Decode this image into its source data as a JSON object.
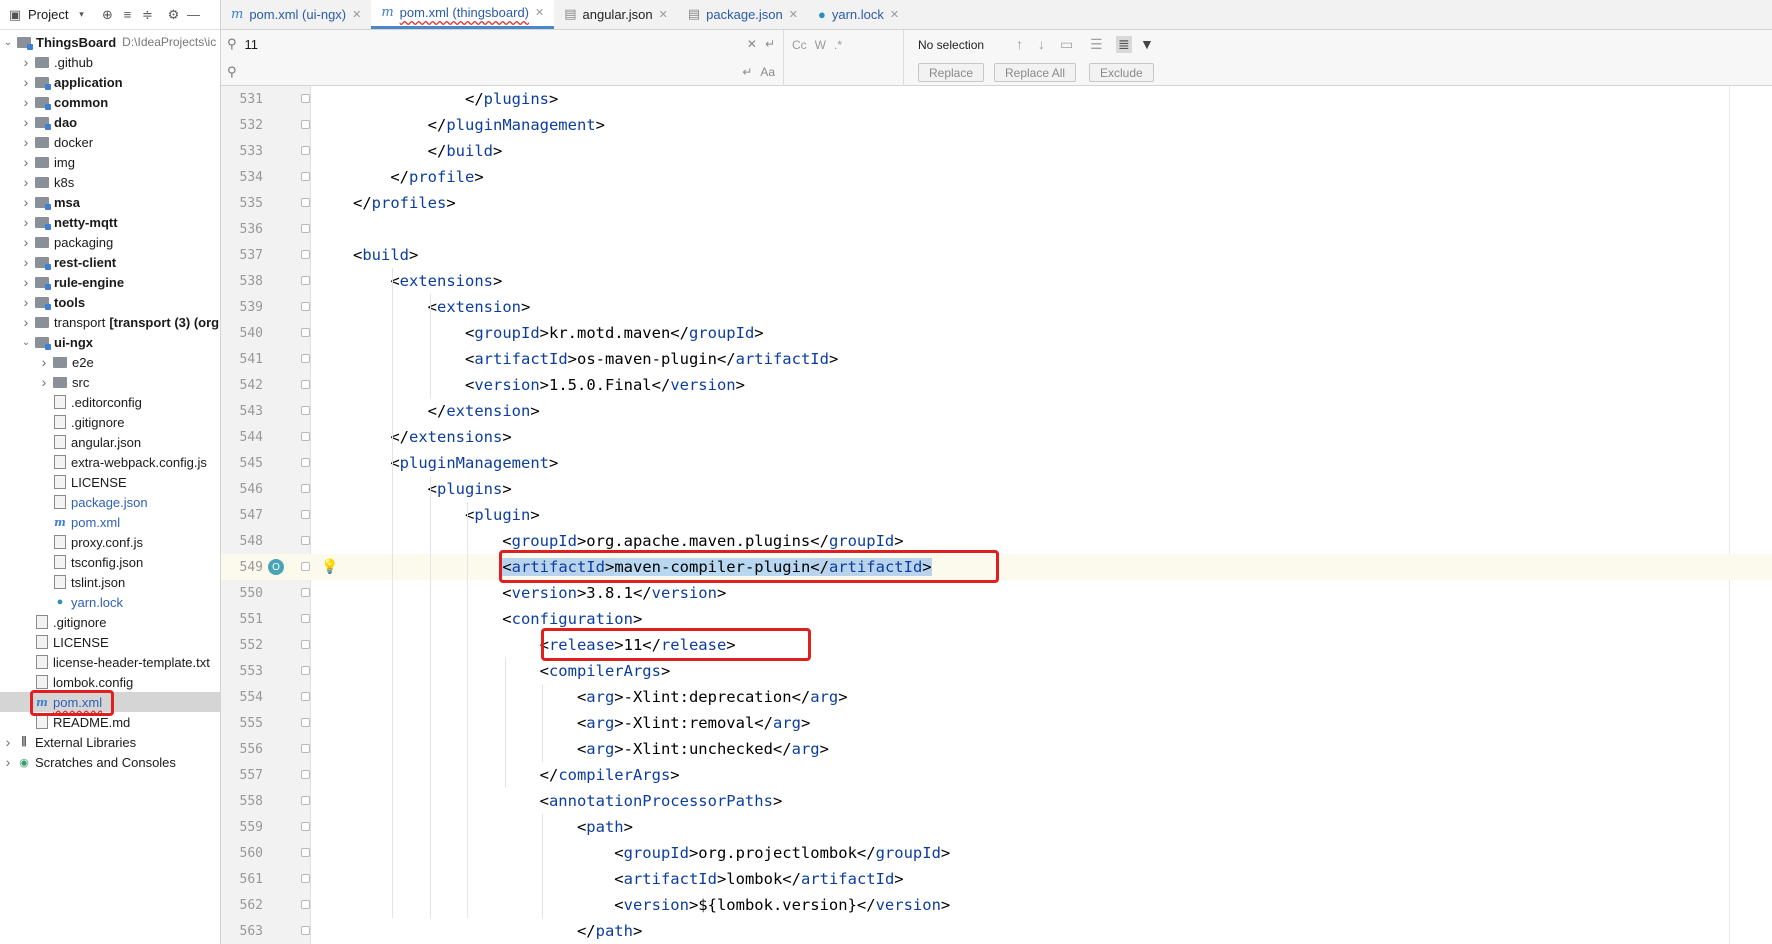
{
  "sidebar": {
    "title": "Project",
    "root_name": "ThingsBoard",
    "root_path": "D:\\IdeaProjects\\ic",
    "items": [
      {
        "label": "ThingsBoard",
        "kind": "root"
      },
      {
        "label": ".github",
        "kind": "folder"
      },
      {
        "label": "application",
        "kind": "module"
      },
      {
        "label": "common",
        "kind": "module"
      },
      {
        "label": "dao",
        "kind": "module"
      },
      {
        "label": "docker",
        "kind": "folder"
      },
      {
        "label": "img",
        "kind": "folder"
      },
      {
        "label": "k8s",
        "kind": "folder"
      },
      {
        "label": "msa",
        "kind": "module"
      },
      {
        "label": "netty-mqtt",
        "kind": "module"
      },
      {
        "label": "packaging",
        "kind": "folder"
      },
      {
        "label": "rest-client",
        "kind": "module"
      },
      {
        "label": "rule-engine",
        "kind": "module"
      },
      {
        "label": "tools",
        "kind": "module"
      },
      {
        "label": "transport",
        "extra": "[transport (3) (org",
        "kind": "folder"
      },
      {
        "label": "ui-ngx",
        "kind": "module"
      },
      {
        "label": "e2e",
        "kind": "folder"
      },
      {
        "label": "src",
        "kind": "folder"
      },
      {
        "label": ".editorconfig",
        "kind": "file"
      },
      {
        "label": ".gitignore",
        "kind": "file"
      },
      {
        "label": "angular.json",
        "kind": "file"
      },
      {
        "label": "extra-webpack.config.js",
        "kind": "file"
      },
      {
        "label": "LICENSE",
        "kind": "file"
      },
      {
        "label": "package.json",
        "kind": "file"
      },
      {
        "label": "pom.xml",
        "kind": "file"
      },
      {
        "label": "proxy.conf.js",
        "kind": "file"
      },
      {
        "label": "tsconfig.json",
        "kind": "file"
      },
      {
        "label": "tslint.json",
        "kind": "file"
      },
      {
        "label": "yarn.lock",
        "kind": "file"
      },
      {
        "label": ".gitignore",
        "kind": "file"
      },
      {
        "label": "LICENSE",
        "kind": "file"
      },
      {
        "label": "license-header-template.txt",
        "kind": "file"
      },
      {
        "label": "lombok.config",
        "kind": "file"
      },
      {
        "label": "pom.xml",
        "kind": "file"
      },
      {
        "label": "README.md",
        "kind": "file"
      },
      {
        "label": "External Libraries",
        "kind": "lib"
      },
      {
        "label": "Scratches and Consoles",
        "kind": "lib"
      }
    ]
  },
  "tabs": [
    {
      "label": "pom.xml (ui-ngx)"
    },
    {
      "label": "pom.xml (thingsboard)"
    },
    {
      "label": "angular.json"
    },
    {
      "label": "package.json"
    },
    {
      "label": "yarn.lock"
    }
  ],
  "search": {
    "query": "11",
    "replace": "",
    "status": "No selection",
    "opt_case": "Cc",
    "opt_word": "W",
    "opt_regex": ".*",
    "replace_button": "Replace",
    "replace_all_button": "Replace All",
    "exclude_button": "Exclude"
  },
  "editor": {
    "lines": [
      {
        "n": "531",
        "code": "            </plugins>"
      },
      {
        "n": "532",
        "code": "        </pluginManagement>"
      },
      {
        "n": "533",
        "code": "        </build>"
      },
      {
        "n": "534",
        "code": "    </profile>"
      },
      {
        "n": "535",
        "code": "</profiles>"
      },
      {
        "n": "536",
        "code": ""
      },
      {
        "n": "537",
        "code": "<build>"
      },
      {
        "n": "538",
        "code": "    <extensions>"
      },
      {
        "n": "539",
        "code": "        <extension>"
      },
      {
        "n": "540",
        "code": "            <groupId>kr.motd.maven</groupId>"
      },
      {
        "n": "541",
        "code": "            <artifactId>os-maven-plugin</artifactId>"
      },
      {
        "n": "542",
        "code": "            <version>1.5.0.Final</version>"
      },
      {
        "n": "543",
        "code": "        </extension>"
      },
      {
        "n": "544",
        "code": "    </extensions>"
      },
      {
        "n": "545",
        "code": "    <pluginManagement>"
      },
      {
        "n": "546",
        "code": "        <plugins>"
      },
      {
        "n": "547",
        "code": "            <plugin>"
      },
      {
        "n": "548",
        "code": "                <groupId>org.apache.maven.plugins</groupId>"
      },
      {
        "n": "549",
        "code": "                <artifactId>maven-compiler-plugin</artifactId>"
      },
      {
        "n": "550",
        "code": "                <version>3.8.1</version>"
      },
      {
        "n": "551",
        "code": "                <configuration>"
      },
      {
        "n": "552",
        "code": "                    <release>11</release>"
      },
      {
        "n": "553",
        "code": "                    <compilerArgs>"
      },
      {
        "n": "554",
        "code": "                        <arg>-Xlint:deprecation</arg>"
      },
      {
        "n": "555",
        "code": "                        <arg>-Xlint:removal</arg>"
      },
      {
        "n": "556",
        "code": "                        <arg>-Xlint:unchecked</arg>"
      },
      {
        "n": "557",
        "code": "                    </compilerArgs>"
      },
      {
        "n": "558",
        "code": "                    <annotationProcessorPaths>"
      },
      {
        "n": "559",
        "code": "                        <path>"
      },
      {
        "n": "560",
        "code": "                            <groupId>org.projectlombok</groupId>"
      },
      {
        "n": "561",
        "code": "                            <artifactId>lombok</artifactId>"
      },
      {
        "n": "562",
        "code": "                            <version>${lombok.version}</version>"
      },
      {
        "n": "563",
        "code": "                        </path>"
      }
    ]
  },
  "colors": {
    "accent": "#4a88c7",
    "tag": "#0b3da0",
    "annotation": "#e02020",
    "current_line": "#fcfaed"
  }
}
